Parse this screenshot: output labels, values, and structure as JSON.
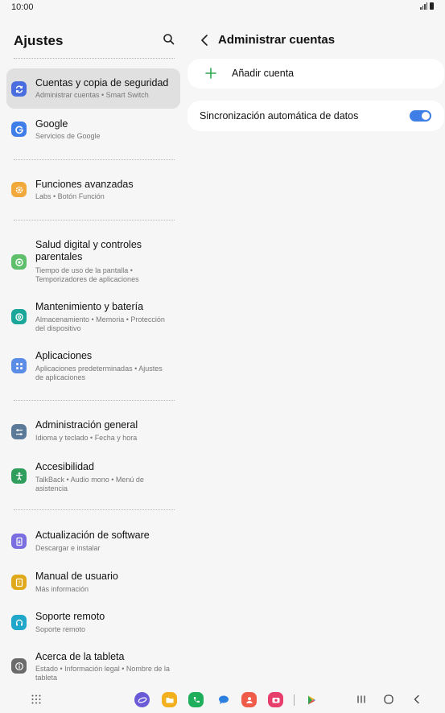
{
  "status_bar": {
    "time": "10:00"
  },
  "left_pane": {
    "title": "Ajustes",
    "items": [
      {
        "title": "Cuentas y copia de seguridad",
        "subtitle": "Administrar cuentas  •  Smart Switch",
        "icon": "sync-icon",
        "color": "#4a6ee0"
      },
      {
        "title": "Google",
        "subtitle": "Servicios de Google",
        "icon": "google-icon",
        "color": "#3f7de8"
      },
      {
        "title": "Funciones avanzadas",
        "subtitle": "Labs  •  Botón Función",
        "icon": "gear-plus-icon",
        "color": "#f2a93b"
      },
      {
        "title": "Salud digital y controles parentales",
        "subtitle": "Tiempo de uso de la pantalla  •  Temporizadores de aplicaciones",
        "icon": "digital-wellbeing-icon",
        "color": "#5fbf6a"
      },
      {
        "title": "Mantenimiento y batería",
        "subtitle": "Almacenamiento  •  Memoria  •  Protección del dispositivo",
        "icon": "device-care-icon",
        "color": "#1aa79a"
      },
      {
        "title": "Aplicaciones",
        "subtitle": "Aplicaciones predeterminadas  •  Ajustes de aplicaciones",
        "icon": "apps-icon",
        "color": "#5b8de6"
      },
      {
        "title": "Administración general",
        "subtitle": "Idioma y teclado  •  Fecha y hora",
        "icon": "sliders-icon",
        "color": "#5b7a9a"
      },
      {
        "title": "Accesibilidad",
        "subtitle": "TalkBack  •  Audio mono  •  Menú de asistencia",
        "icon": "accessibility-icon",
        "color": "#2f9e5c"
      },
      {
        "title": "Actualización de software",
        "subtitle": "Descargar e instalar",
        "icon": "software-update-icon",
        "color": "#7a6ee0"
      },
      {
        "title": "Manual de usuario",
        "subtitle": "Más información",
        "icon": "user-manual-icon",
        "color": "#e0a91c"
      },
      {
        "title": "Soporte remoto",
        "subtitle": "Soporte remoto",
        "icon": "headset-icon",
        "color": "#20a7c9"
      },
      {
        "title": "Acerca de la tableta",
        "subtitle": "Estado  •  Información legal  •  Nombre de la tableta",
        "icon": "info-icon",
        "color": "#6b6b6b"
      }
    ]
  },
  "right_pane": {
    "title": "Administrar cuentas",
    "add_account_label": "Añadir cuenta",
    "sync_label": "Sincronización automática de datos",
    "sync_enabled": true
  },
  "navigation_bar": {
    "dock_apps": [
      {
        "name": "internet-icon",
        "color": "#6a5ad8"
      },
      {
        "name": "my-files-icon",
        "color": "#f2b01e"
      },
      {
        "name": "phone-icon",
        "color": "#1fae5b"
      },
      {
        "name": "messages-icon",
        "color": "#2d7fe0"
      },
      {
        "name": "contacts-icon",
        "color": "#f05c4a"
      },
      {
        "name": "screen-recorder-icon",
        "color": "#e83e6c"
      },
      {
        "name": "play-store-icon",
        "color": "#2fa84f"
      }
    ]
  },
  "colors": {
    "accent": "#3e7ee6",
    "background": "#f6f6f6",
    "selected": "#e0e0e0"
  }
}
